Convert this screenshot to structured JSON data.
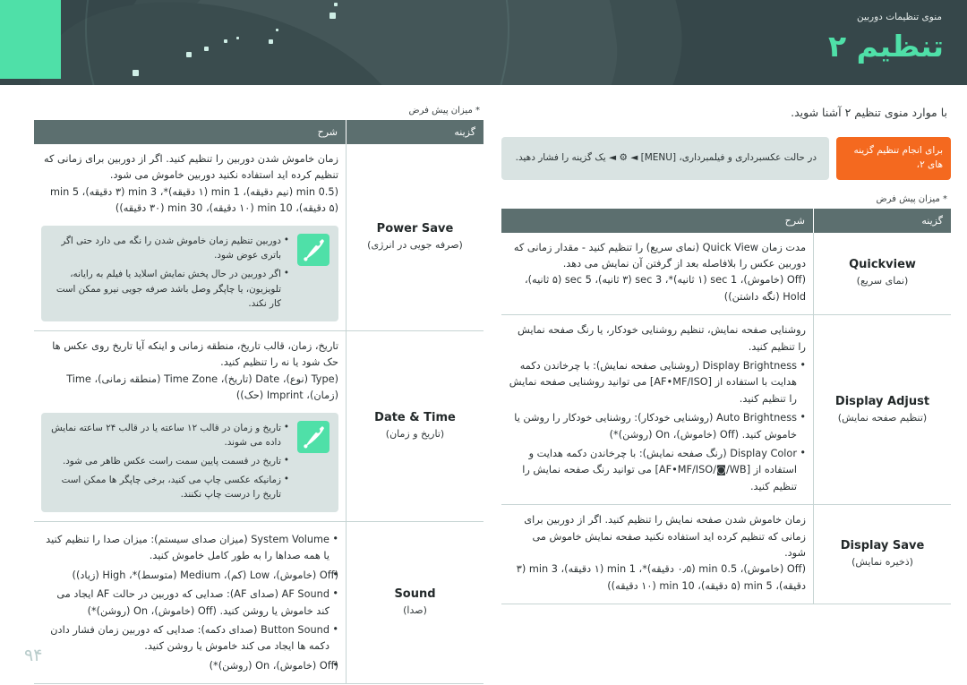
{
  "header": {
    "subtitle": "منوی تنظیمات دوربین",
    "title": "تنظیم ۲"
  },
  "page_number": "۹۴",
  "right_page": {
    "intro": "با موارد منوی تنظیم ۲ آشنا شوید.",
    "badge": "برای انجام تنظیم گزینه های ۲،",
    "hint": "در حالت عکسبرداری و فیلمبرداری، [MENU] ◄ ⚙ ◄ یک گزینه را فشار دهید.",
    "default_note": "* میزان پیش فرض",
    "table": {
      "header_option": "گزینه",
      "header_desc": "شرح",
      "rows": [
        {
          "option_en": "Quickview",
          "option_fa": "(نمای سریع)",
          "desc": "مدت زمان Quick View (نمای سریع) را تنظیم کنید - مقدار زمانی که دوربین عکس را بلافاصله بعد از گرفتن آن نمایش می دهد.",
          "values": "(Off (خاموش)، 1 sec (۱ ثانیه)*، 3 sec (۳ ثانیه)، 5 sec (۵ ثانیه)، Hold (نگه داشتن))",
          "bullets": [],
          "note_bullets": []
        },
        {
          "option_en": "Display Adjust",
          "option_fa": "(تنظیم صفحه نمایش)",
          "desc": "روشنایی صفحه نمایش، تنظیم روشنایی خودکار، یا رنگ صفحه نمایش را تنظیم کنید.",
          "values": "",
          "bullets": [
            "Display Brightness (روشنایی صفحه نمایش): با چرخاندن دکمه هدایت با استفاده از [AF•MF/ISO] می توانید روشنایی صفحه نمایش را تنظیم کنید.",
            "Auto Brightness (روشنایی خودکار): روشنایی خودکار را روشن یا خاموش کنید. (Off (خاموش)، On (روشن)*)",
            "Display Color (رنگ صفحه نمایش): با چرخاندن دکمه هدایت و استفاده از [AF•MF/ISO/◙/WB] می توانید رنگ صفحه نمایش را تنظیم کنید."
          ],
          "note_bullets": []
        },
        {
          "option_en": "Display Save",
          "option_fa": "(ذخیره نمایش)",
          "desc": "زمان خاموش شدن صفحه نمایش را تنظیم کنید. اگر از دوربین برای زمانی که تنظیم کرده اید استفاده نکنید صفحه نمایش خاموش می شود.",
          "values": "(Off (خاموش)، 0.5 min (۰٫۵ دقیقه)*، 1 min (۱ دقیقه)، 3 min (۳ دقیقه)، 5 min (۵ دقیقه)، 10 min (۱۰ دقیقه))",
          "bullets": [],
          "note_bullets": []
        }
      ]
    }
  },
  "left_page": {
    "default_note": "* میزان پیش فرض",
    "table": {
      "header_option": "گزینه",
      "header_desc": "شرح",
      "rows": [
        {
          "option_en": "Power Save",
          "option_fa": "(صرفه جویی در انرژی)",
          "desc": "زمان خاموش شدن دوربین را تنظیم کنید. اگر از دوربین برای زمانی که تنظیم کرده اید استفاده نکنید دوربین خاموش می شود.",
          "values": "(0.5 min (نیم دقیقه)، 1 min (۱ دقیقه)*، 3 min (۳ دقیقه)، 5 min (۵ دقیقه)، 10 min (۱۰ دقیقه)، 30 min (۳۰ دقیقه))",
          "bullets": [],
          "note_bullets": [
            "دوربین تنظیم زمان خاموش شدن را نگه می دارد حتی اگر باتری عوض شود.",
            "اگر دوربین در حال پخش نمایش اسلاید یا فیلم به رایانه، تلویزیون، یا چاپگر وصل باشد صرفه جویی نیرو ممکن است کار نکند."
          ]
        },
        {
          "option_en": "Date & Time",
          "option_fa": "(تاریخ و زمان)",
          "desc": "تاریخ، زمان، قالب تاریخ، منطقه زمانی و اینکه آیا تاریخ روی عکس ها حک شود یا نه را تنظیم کنید.",
          "values": "(Type (نوع)، Date (تاریخ)، Time Zone (منطقه زمانی)، Time (زمان)، Imprint (حک))",
          "bullets": [],
          "note_bullets": [
            "تاریخ و زمان در قالب ۱۲ ساعته یا در قالب ۲۴ ساعته نمایش داده می شوند.",
            "تاریخ در قسمت پایین سمت راست عکس ظاهر می شود.",
            "زمانیکه عکسی چاپ می کنید، برخی چاپگر ها ممکن است تاریخ را درست چاپ نکنند."
          ]
        },
        {
          "option_en": "Sound",
          "option_fa": "(صدا)",
          "desc": "",
          "values": "",
          "bullets": [
            "System Volume (میزان صدای سیستم): میزان صدا را تنظیم کنید یا همه صداها را به طور کامل خاموش کنید.",
            "(Off (خاموش)، Low (کم)، Medium (متوسط)*، High (زیاد))",
            "AF Sound (صدای AF): صدایی که دوربین در حالت AF ایجاد می کند خاموش یا روشن کنید. (Off (خاموش)، On (روشن)*)",
            "Button Sound (صدای دکمه): صدایی که دوربین زمان فشار دادن دکمه ها ایجاد می کند خاموش یا روشن کنید.",
            "(Off (خاموش)، On (روشن)*)"
          ],
          "note_bullets": []
        }
      ]
    }
  }
}
